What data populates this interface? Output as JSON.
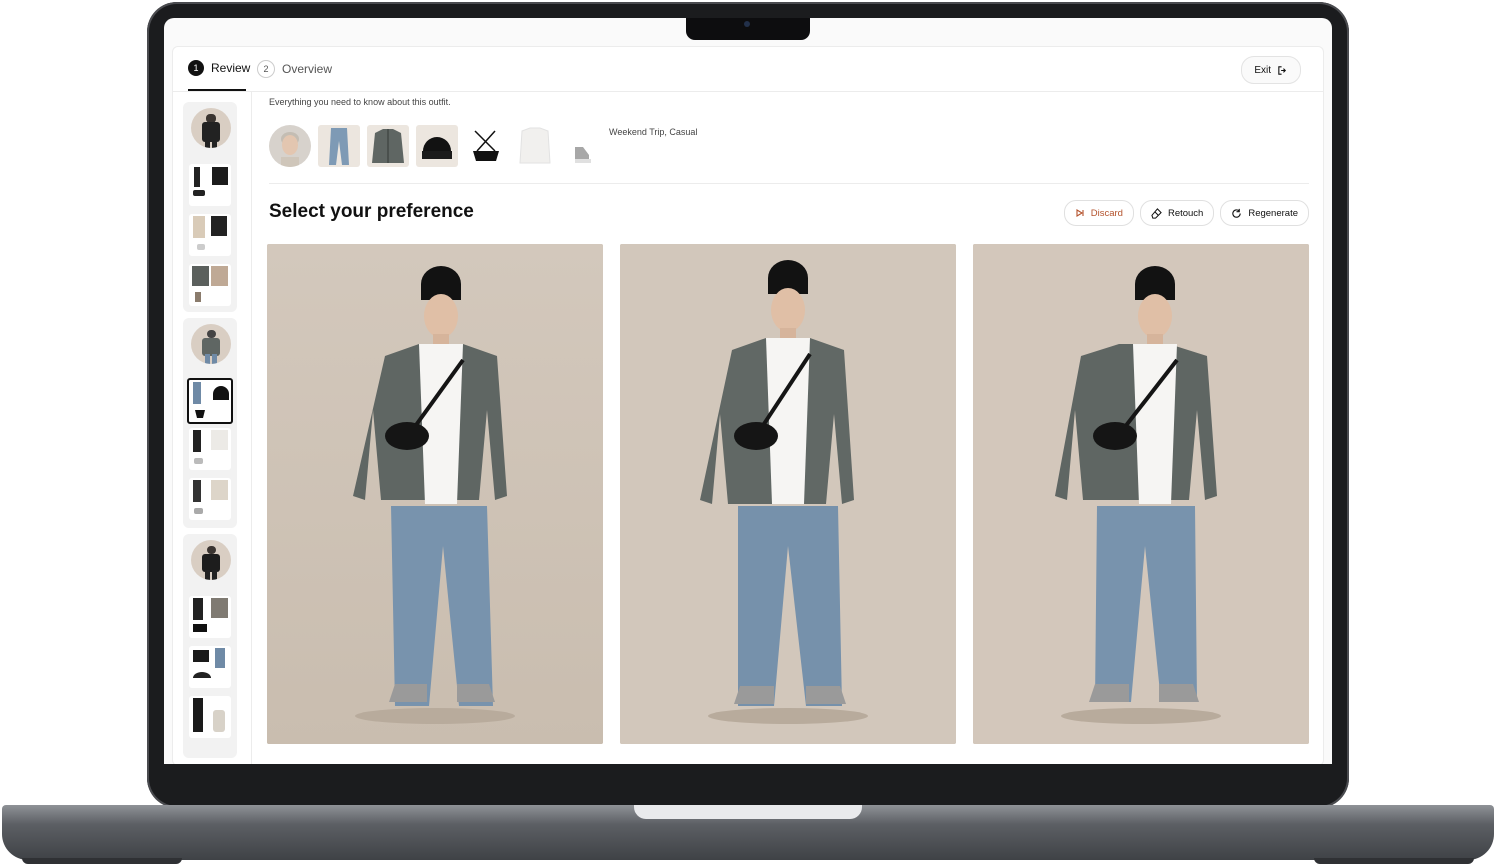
{
  "steps": [
    {
      "num": "1",
      "label": "Review"
    },
    {
      "num": "2",
      "label": "Overview"
    }
  ],
  "exit_label": "Exit",
  "description": "Everything you need to know about this outfit.",
  "tags": "Weekend Trip, Casual",
  "section_title": "Select your preference",
  "actions": {
    "discard": "Discard",
    "retouch": "Retouch",
    "regenerate": "Regenerate"
  },
  "icons": [
    "arrow-exit-icon",
    "skip-icon",
    "eraser-icon",
    "refresh-icon"
  ],
  "colors": {
    "accent": "#111111",
    "discard": "#b4532d",
    "backdrop": "#d3c8bc"
  }
}
